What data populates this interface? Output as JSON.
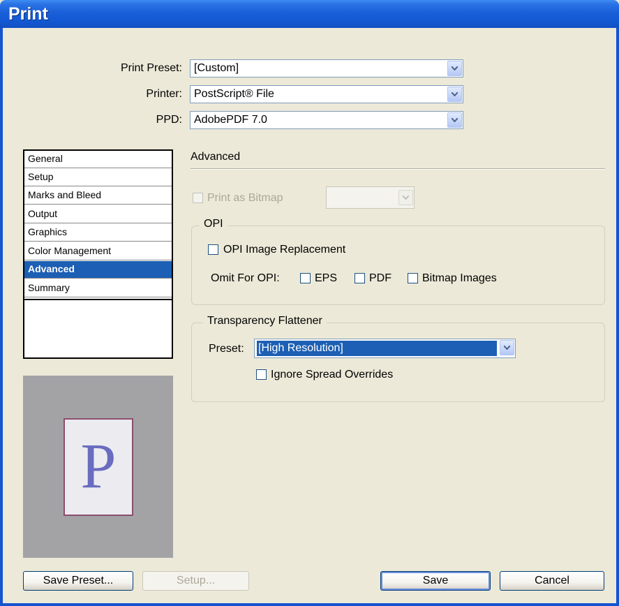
{
  "window": {
    "title": "Print"
  },
  "top_fields": {
    "print_preset": {
      "label": "Print Preset:",
      "value": "[Custom]"
    },
    "printer": {
      "label": "Printer:",
      "value": "PostScript® File"
    },
    "ppd": {
      "label": "PPD:",
      "value": "AdobePDF 7.0"
    }
  },
  "sidebar": {
    "items": [
      {
        "label": "General"
      },
      {
        "label": "Setup"
      },
      {
        "label": "Marks and Bleed"
      },
      {
        "label": "Output"
      },
      {
        "label": "Graphics"
      },
      {
        "label": "Color Management"
      },
      {
        "label": "Advanced",
        "selected": true
      },
      {
        "label": "Summary"
      }
    ]
  },
  "preview": {
    "letter": "P"
  },
  "advanced": {
    "heading": "Advanced",
    "print_as_bitmap": {
      "label": "Print as Bitmap",
      "checked": false,
      "enabled": false,
      "dropdown_value": ""
    },
    "opi": {
      "title": "OPI",
      "image_replacement": {
        "label": "OPI Image Replacement",
        "checked": false
      },
      "omit_label": "Omit For OPI:",
      "eps": {
        "label": "EPS",
        "checked": false
      },
      "pdf": {
        "label": "PDF",
        "checked": false
      },
      "bitmap": {
        "label": "Bitmap Images",
        "checked": false
      }
    },
    "flattener": {
      "title": "Transparency Flattener",
      "preset_label": "Preset:",
      "preset_value": "[High Resolution]",
      "ignore_overrides": {
        "label": "Ignore Spread Overrides",
        "checked": false
      }
    }
  },
  "buttons": {
    "save_preset": "Save Preset...",
    "setup": "Setup...",
    "save": "Save",
    "cancel": "Cancel"
  },
  "colors": {
    "title_bar": "#1553d0",
    "selection": "#1c5fb4",
    "dialog_bg": "#ece9d8"
  }
}
